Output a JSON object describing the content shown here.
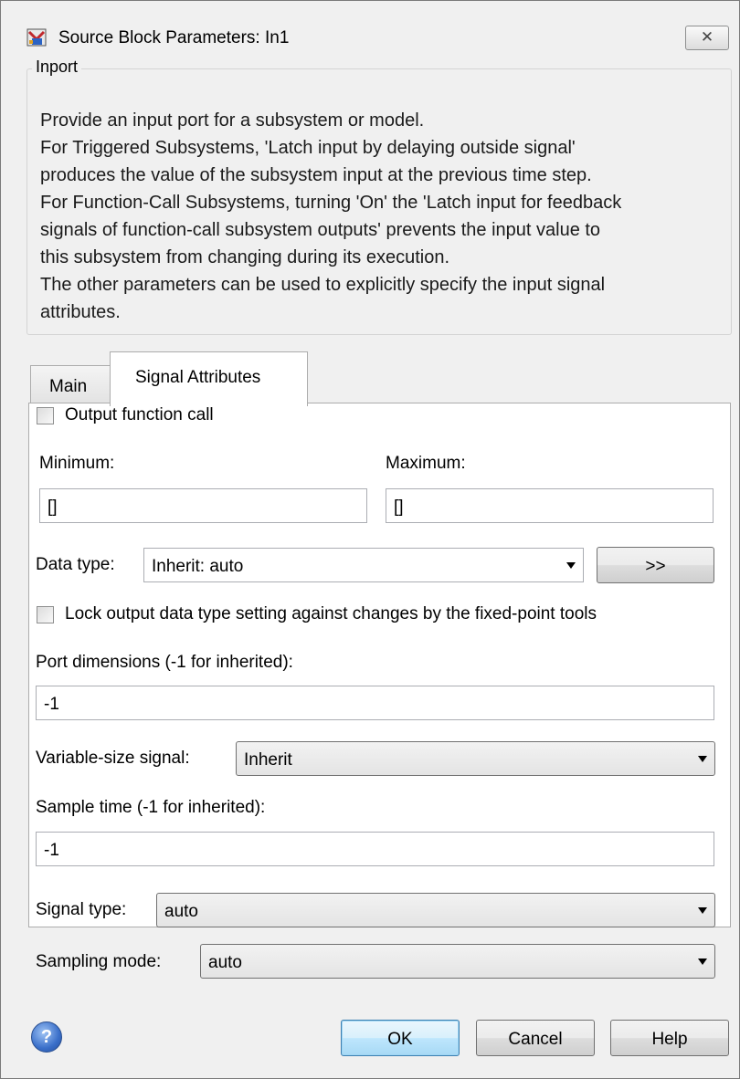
{
  "window": {
    "title": "Source Block Parameters: In1",
    "close_glyph": "✕"
  },
  "group": {
    "title": "Inport",
    "description": [
      "Provide an input port for a subsystem or model.",
      "For Triggered Subsystems, 'Latch input by delaying outside signal'",
      "produces the value of the subsystem input at the previous time step.",
      "For Function-Call Subsystems, turning 'On' the 'Latch input for feedback",
      "signals of function-call subsystem outputs' prevents the input value to",
      "this subsystem from changing during its execution.",
      "The other parameters can be used to explicitly specify the input signal",
      "attributes."
    ]
  },
  "tabs": [
    {
      "label": "Main",
      "active": false
    },
    {
      "label": "Signal Attributes",
      "active": true
    }
  ],
  "form": {
    "output_function_call": {
      "label": "Output function call",
      "checked": false
    },
    "minimum": {
      "label": "Minimum:",
      "value": "[]"
    },
    "maximum": {
      "label": "Maximum:",
      "value": "[]"
    },
    "data_type": {
      "label": "Data type:",
      "value": "Inherit: auto",
      "button": ">>"
    },
    "lock_output": {
      "label": "Lock output data type setting against changes by the fixed-point tools",
      "checked": false
    },
    "port_dimensions": {
      "label": "Port dimensions (-1 for inherited):",
      "value": "-1"
    },
    "variable_size": {
      "label": "Variable-size signal:",
      "value": "Inherit"
    },
    "sample_time": {
      "label": "Sample time (-1 for inherited):",
      "value": "-1"
    },
    "signal_type": {
      "label": "Signal type:",
      "value": "auto"
    },
    "sampling_mode": {
      "label": "Sampling mode:",
      "value": "auto"
    }
  },
  "buttons": {
    "help_icon": "?",
    "ok": "OK",
    "cancel": "Cancel",
    "help": "Help"
  }
}
